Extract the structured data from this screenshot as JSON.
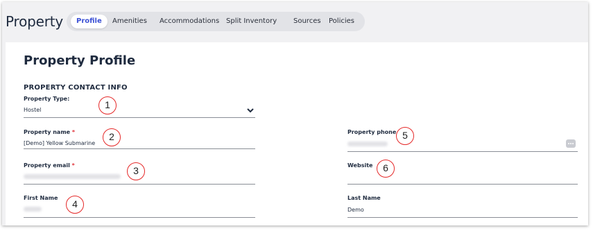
{
  "header": {
    "title": "Property",
    "tabs": [
      {
        "label": "Profile",
        "active": true
      },
      {
        "label": "Amenities",
        "active": false
      },
      {
        "label": "Accommodations",
        "active": false
      },
      {
        "label": "Split Inventory",
        "active": false
      },
      {
        "label": "Sources",
        "active": false
      },
      {
        "label": "Policies",
        "active": false
      }
    ]
  },
  "main": {
    "title": "Property Profile",
    "section_title": "PROPERTY CONTACT INFO",
    "fields": {
      "property_type": {
        "label": "Property Type:",
        "value": "Hostel"
      },
      "property_name": {
        "label": "Property name",
        "required_mark": "*",
        "value": "[Demo] Yellow Submarine"
      },
      "property_email": {
        "label": "Property email",
        "required_mark": "*"
      },
      "first_name": {
        "label": "First Name"
      },
      "property_phone": {
        "label": "Property phone",
        "required_mark": "*"
      },
      "website": {
        "label": "Website"
      },
      "last_name": {
        "label": "Last Name",
        "value": "Demo"
      }
    }
  },
  "annotations": [
    "1",
    "2",
    "3",
    "4",
    "5",
    "6"
  ],
  "colors": {
    "accent": "#3d52d5",
    "required": "#e0333a",
    "marker": "#e52929"
  }
}
